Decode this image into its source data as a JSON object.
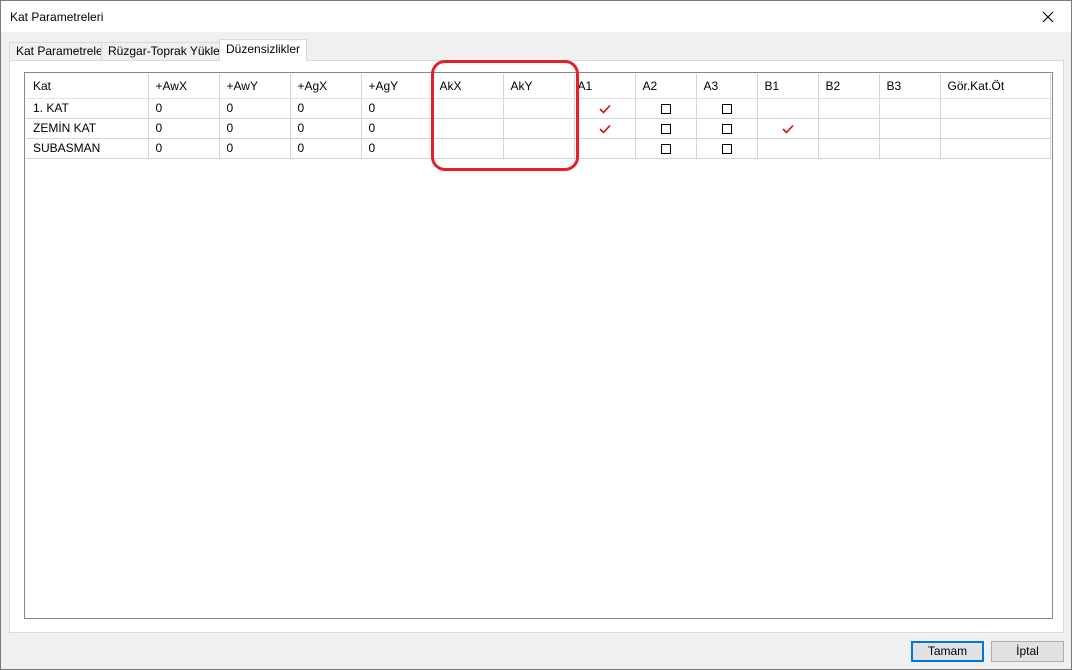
{
  "window": {
    "title": "Kat Parametreleri"
  },
  "tabs": [
    {
      "label": "Kat Parametreleri"
    },
    {
      "label": "Rüzgar-Toprak Yükleri"
    },
    {
      "label": "Düzensizlikler"
    }
  ],
  "table": {
    "columns": [
      "Kat",
      "+AwX",
      "+AwY",
      "+AgX",
      "+AgY",
      "AkX",
      "AkY",
      "A1",
      "A2",
      "A3",
      "B1",
      "B2",
      "B3",
      "Gör.Kat.Öt"
    ],
    "rows": [
      {
        "kat": "1. KAT",
        "awx": "0",
        "awy": "0",
        "agx": "0",
        "agy": "0",
        "akx": "",
        "aky": "",
        "a1": "checked",
        "a2": "unchecked",
        "a3": "unchecked",
        "b1": "none",
        "b2": "none",
        "b3": "none",
        "gor": ""
      },
      {
        "kat": "ZEMİN KAT",
        "awx": "0",
        "awy": "0",
        "agx": "0",
        "agy": "0",
        "akx": "",
        "aky": "",
        "a1": "checked",
        "a2": "unchecked",
        "a3": "unchecked",
        "b1": "checked",
        "b2": "none",
        "b3": "none",
        "gor": ""
      },
      {
        "kat": "SUBASMAN",
        "awx": "0",
        "awy": "0",
        "agx": "0",
        "agy": "0",
        "akx": "",
        "aky": "",
        "a1": "none",
        "a2": "unchecked",
        "a3": "unchecked",
        "b1": "none",
        "b2": "none",
        "b3": "none",
        "gor": ""
      }
    ]
  },
  "buttons": {
    "ok": "Tamam",
    "cancel": "İptal"
  },
  "icons": {
    "close": "close-icon",
    "check": "checkmark-icon",
    "checkbox": "checkbox-icon"
  },
  "colors": {
    "check": "#d01010",
    "highlight": "#e5202b",
    "accent": "#0078d7"
  }
}
